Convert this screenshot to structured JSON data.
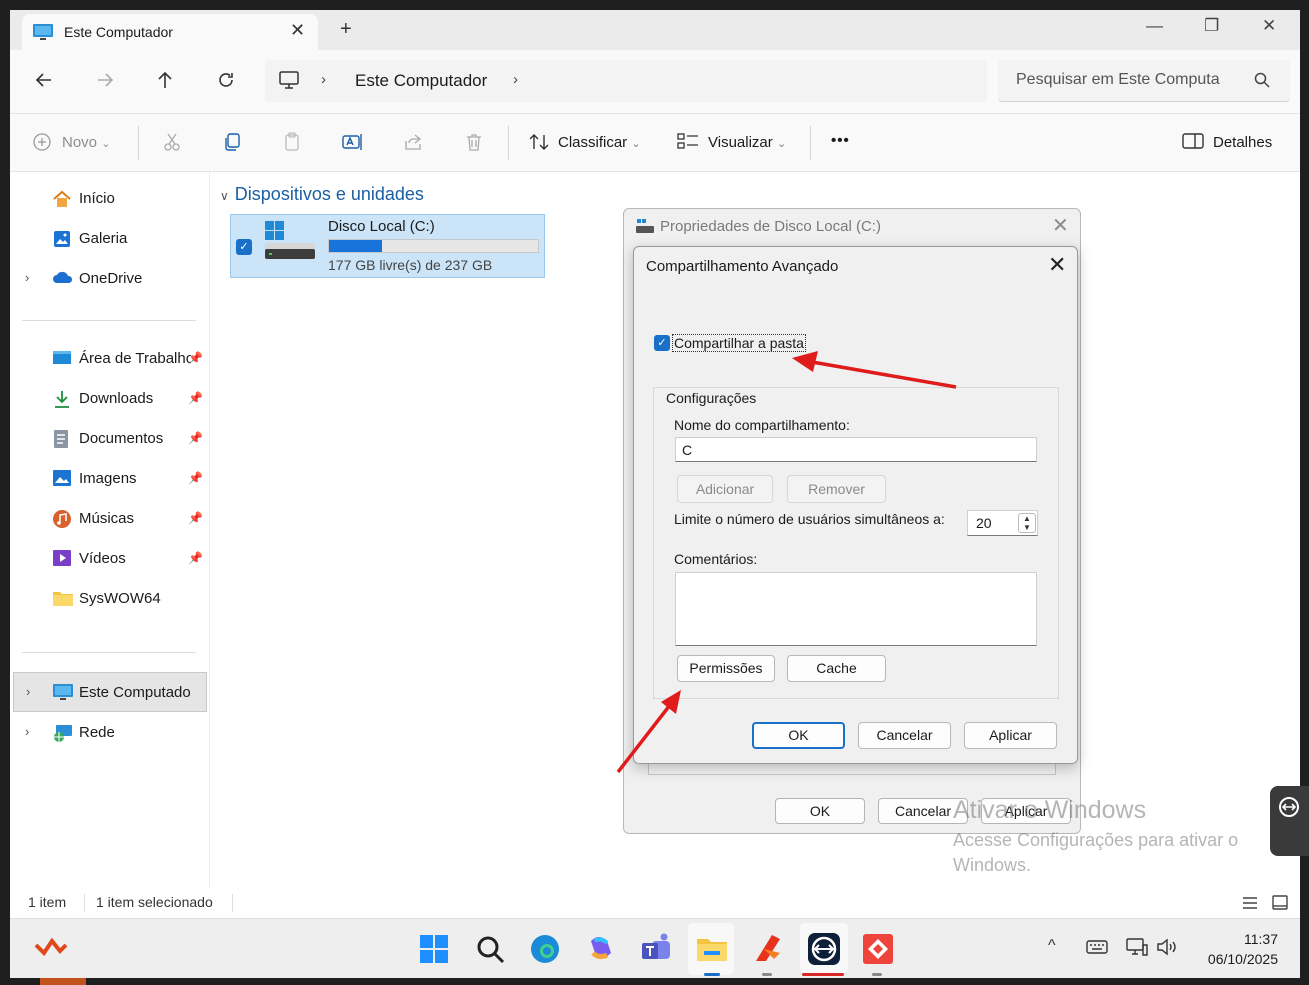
{
  "window": {
    "tab_title": "Este Computador",
    "tab_close": "✕",
    "new_tab": "+",
    "minimize": "—",
    "restore": "❐",
    "close": "✕"
  },
  "address": {
    "crumb": "Este Computador",
    "sep": "›",
    "search_placeholder": "Pesquisar em Este Computa"
  },
  "toolbar": {
    "new_label": "Novo",
    "sort_label": "Classificar",
    "view_label": "Visualizar",
    "more_label": "•••",
    "details_label": "Detalhes",
    "caret": "⌄"
  },
  "sidebar": {
    "items": [
      {
        "label": "Início",
        "icon": "home-icon"
      },
      {
        "label": "Galeria",
        "icon": "gallery-icon"
      },
      {
        "label": "OneDrive",
        "icon": "cloud-icon"
      },
      {
        "label": "Área de Trabalho",
        "icon": "desktop-icon"
      },
      {
        "label": "Downloads",
        "icon": "download-icon"
      },
      {
        "label": "Documentos",
        "icon": "document-icon"
      },
      {
        "label": "Imagens",
        "icon": "image-icon"
      },
      {
        "label": "Músicas",
        "icon": "music-icon"
      },
      {
        "label": "Vídeos",
        "icon": "video-icon"
      },
      {
        "label": "SysWOW64",
        "icon": "folder-icon"
      },
      {
        "label": "Este Computador",
        "icon": "computer-icon"
      },
      {
        "label": "Rede",
        "icon": "network-icon"
      }
    ],
    "chevron": "›",
    "pin": "📌"
  },
  "content": {
    "group_header": "Dispositivos e unidades",
    "drive": {
      "name": "Disco Local (C:)",
      "free_text": "177 GB livre(s) de 237 GB",
      "used_fraction": 0.253
    }
  },
  "status": {
    "count": "1 item",
    "selected": "1 item selecionado"
  },
  "properties_dialog": {
    "title": "Propriedades de Disco Local (C:)",
    "close": "✕",
    "ok": "OK",
    "cancel": "Cancelar",
    "apply": "Aplicar"
  },
  "advanced_sharing": {
    "title": "Compartilhamento Avançado",
    "close": "✕",
    "share_checkbox": "Compartilhar a pasta",
    "share_checked": true,
    "group_label": "Configurações",
    "share_name_label": "Nome do compartilhamento:",
    "share_name_value": "C",
    "add_button": "Adicionar",
    "remove_button": "Remover",
    "limit_label": "Limite o número de usuários simultâneos a:",
    "limit_value": "20",
    "comments_label": "Comentários:",
    "comments_value": "",
    "permissions_button": "Permissões",
    "cache_button": "Cache",
    "ok": "OK",
    "cancel": "Cancelar",
    "apply": "Aplicar"
  },
  "watermark": {
    "line1": "Ativar o Windows",
    "line2": "Acesse Configurações para ativar o Windows."
  },
  "taskbar": {
    "time": "11:37",
    "date": "06/10/2025",
    "tray_chevron": "^"
  },
  "colors": {
    "accent": "#1a6fc9",
    "annotation_arrow": "#e01b1b",
    "selection": "#cce4f7"
  }
}
